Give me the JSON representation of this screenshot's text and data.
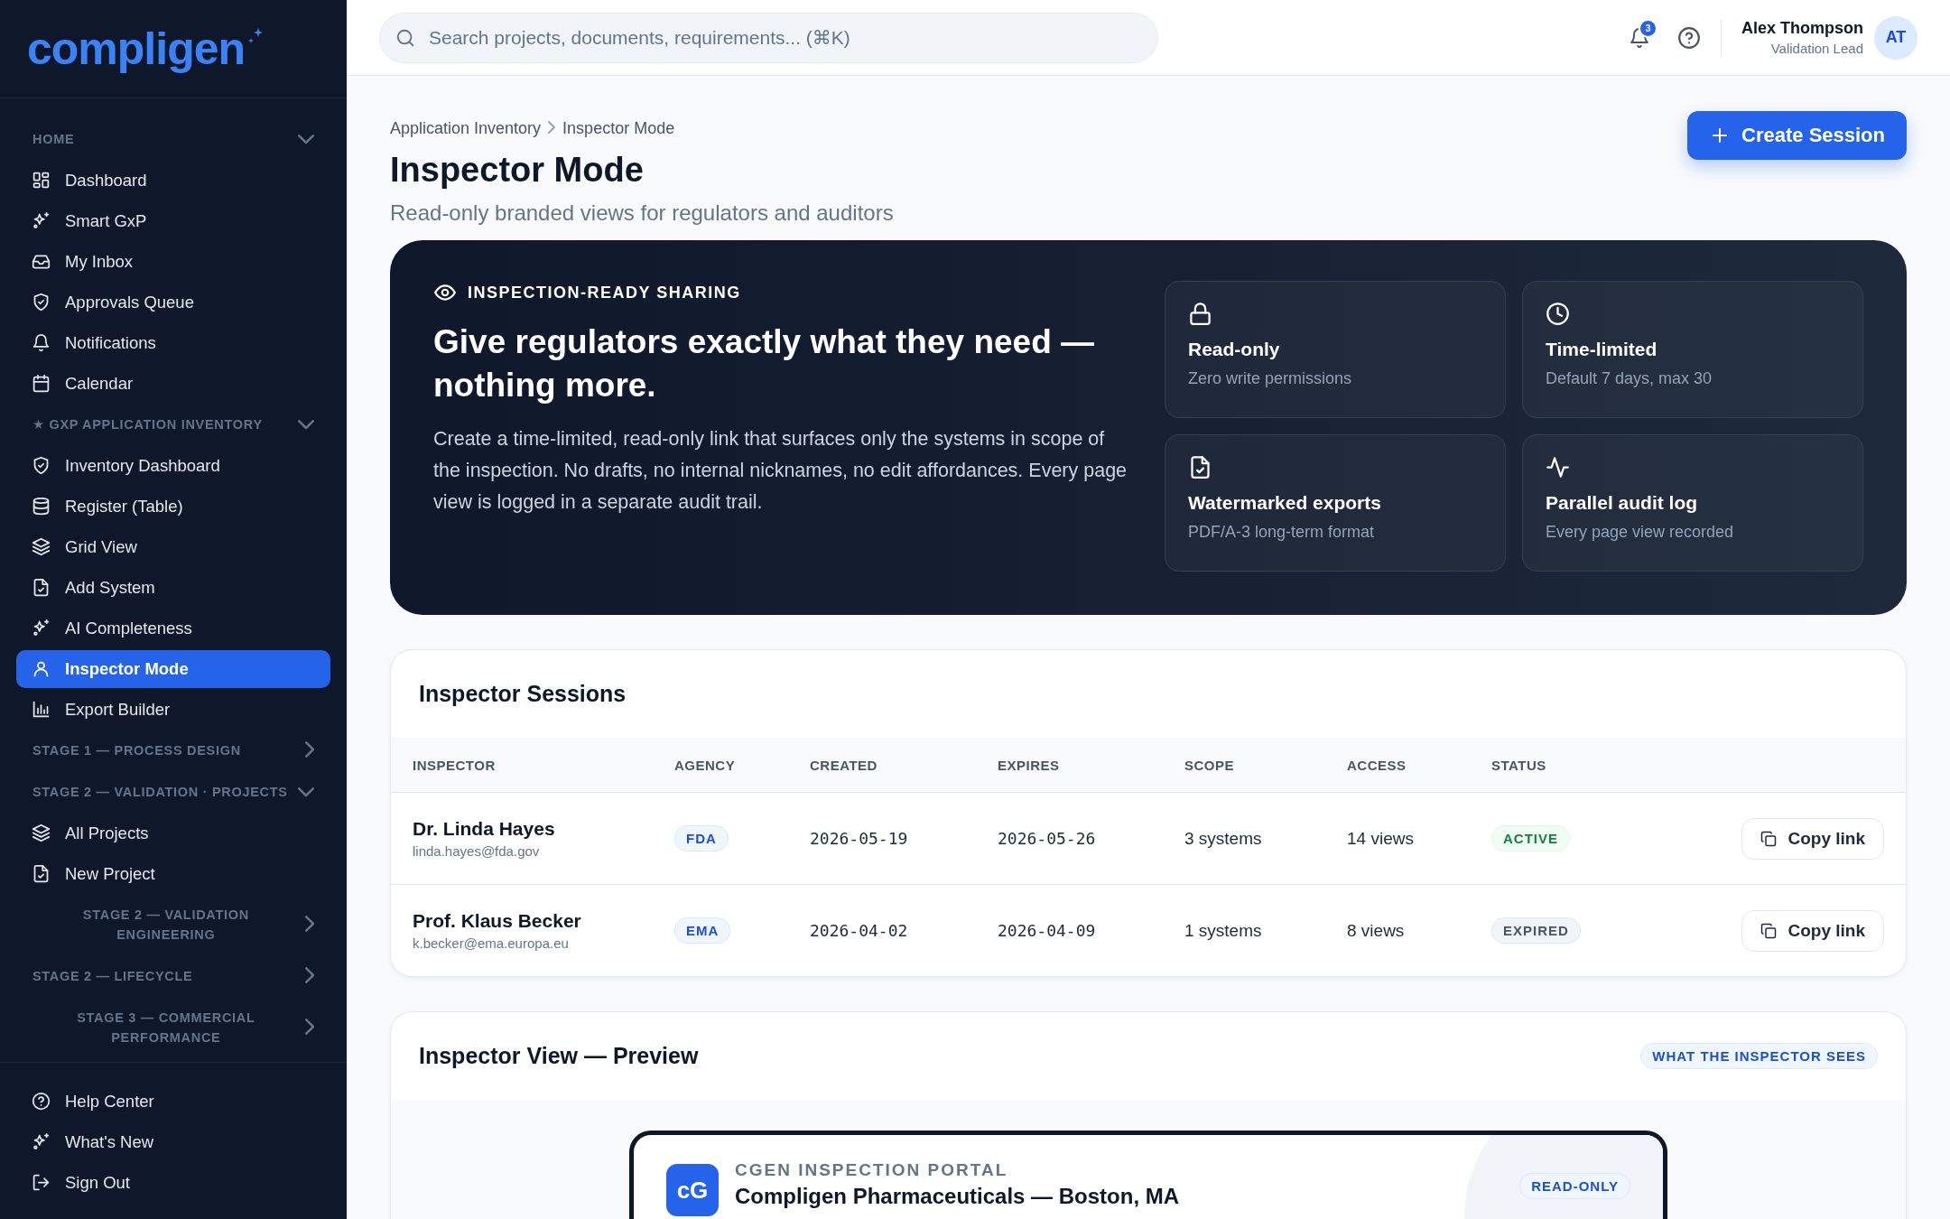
{
  "sidebar": {
    "logo": "compligen",
    "sections": [
      {
        "label": "HOME",
        "expanded": true,
        "items": [
          {
            "label": "Dashboard",
            "selected": false
          },
          {
            "label": "Smart GxP",
            "selected": false
          },
          {
            "label": "My Inbox",
            "selected": false
          },
          {
            "label": "Approvals Queue",
            "selected": false
          },
          {
            "label": "Notifications",
            "selected": false
          },
          {
            "label": "Calendar",
            "selected": false
          }
        ]
      },
      {
        "label": "★ GXP APPLICATION INVENTORY",
        "expanded": true,
        "items": [
          {
            "label": "Inventory Dashboard",
            "selected": false
          },
          {
            "label": "Register (Table)",
            "selected": false
          },
          {
            "label": "Grid View",
            "selected": false
          },
          {
            "label": "Add System",
            "selected": false
          },
          {
            "label": "AI Completeness",
            "selected": false
          },
          {
            "label": "Inspector Mode",
            "selected": true
          },
          {
            "label": "Export Builder",
            "selected": false
          }
        ]
      },
      {
        "label": "STAGE 1 — PROCESS DESIGN",
        "expanded": false
      },
      {
        "label": "STAGE 2 — VALIDATION · PROJECTS",
        "expanded": true,
        "items": [
          {
            "label": "All Projects",
            "selected": false
          },
          {
            "label": "New Project",
            "selected": false
          }
        ]
      },
      {
        "label": "STAGE 2 — VALIDATION ENGINEERING",
        "expanded": false
      },
      {
        "label": "STAGE 2 — LIFECYCLE",
        "expanded": false
      },
      {
        "label": "STAGE 3 — COMMERCIAL PERFORMANCE",
        "expanded": false
      }
    ],
    "footer_items": [
      {
        "label": "Help Center",
        "selected": false
      },
      {
        "label": "What's New",
        "selected": false
      },
      {
        "label": "Sign Out",
        "selected": false
      }
    ]
  },
  "top_bar": {
    "search": {
      "placeholder": "Search projects, documents, requirements... (⌘K)"
    },
    "notification_count": "3",
    "user": {
      "name": "Alex Thompson",
      "role": "Validation Lead",
      "initials": "AT"
    }
  },
  "page": {
    "breadcrumb": [
      "Application Inventory",
      "Inspector Mode"
    ],
    "title": "Inspector Mode",
    "subtitle": "Read-only branded views for regulators and auditors",
    "primary_button": "Create Session"
  },
  "hero": {
    "eyebrow": "INSPECTION-READY SHARING",
    "headline": "Give regulators exactly what they need — nothing more.",
    "body": "Create a time-limited, read-only link that surfaces only the systems in scope of the inspection. No drafts, no internal nicknames, no edit affordances. Every page view is logged in a separate audit trail.",
    "features": [
      {
        "title": "Read-only",
        "detail": "Zero write permissions"
      },
      {
        "title": "Time-limited",
        "detail": "Default 7 days, max 30"
      },
      {
        "title": "Watermarked exports",
        "detail": "PDF/A-3 long-term format"
      },
      {
        "title": "Parallel audit log",
        "detail": "Every page view recorded"
      }
    ]
  },
  "sessions": {
    "title": "Inspector Sessions",
    "columns": [
      "INSPECTOR",
      "AGENCY",
      "CREATED",
      "EXPIRES",
      "SCOPE",
      "ACCESS",
      "STATUS"
    ],
    "rows": [
      {
        "name": "Dr. Linda Hayes",
        "email": "linda.hayes@fda.gov",
        "agency": "FDA",
        "created": "2026-05-19",
        "expires": "2026-05-26",
        "scope": "3 systems",
        "access": "14 views",
        "status": {
          "label": "ACTIVE",
          "kind": "active"
        },
        "action": "Copy link"
      },
      {
        "name": "Prof. Klaus Becker",
        "email": "k.becker@ema.europa.eu",
        "agency": "EMA",
        "created": "2026-04-02",
        "expires": "2026-04-09",
        "scope": "1 systems",
        "access": "8 views",
        "status": {
          "label": "EXPIRED",
          "kind": "expired"
        },
        "action": "Copy link"
      }
    ]
  },
  "preview": {
    "title": "Inspector View — Preview",
    "badge": "WHAT THE INSPECTOR SEES",
    "portal": {
      "logo": "cG",
      "eyebrow": "CGEN INSPECTION PORTAL",
      "company": "Compligen Pharmaceuticals — Boston, MA",
      "badge": "READ-ONLY"
    }
  }
}
